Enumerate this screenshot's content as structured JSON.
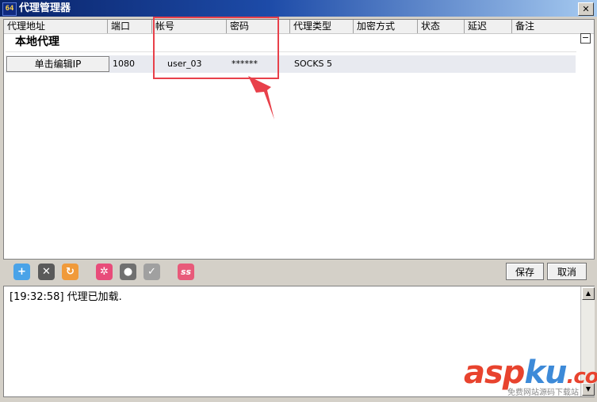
{
  "window": {
    "title": "代理管理器",
    "app_icon_text": "64",
    "close_glyph": "✕"
  },
  "columns": [
    {
      "label": "代理地址"
    },
    {
      "label": "端口"
    },
    {
      "label": "帐号"
    },
    {
      "label": "密码"
    },
    {
      "label": "代理类型"
    },
    {
      "label": "加密方式"
    },
    {
      "label": "状态"
    },
    {
      "label": "延迟"
    },
    {
      "label": "备注"
    }
  ],
  "group": {
    "title": "本地代理",
    "collapse_glyph": "−"
  },
  "rows": [
    {
      "address_button": "单击编辑IP",
      "port": "1080",
      "account": "user_03",
      "password": "******",
      "type": "SOCKS 5",
      "encryption": "",
      "status": "",
      "latency": "",
      "note": ""
    }
  ],
  "toolbar": {
    "icons": [
      {
        "name": "add-icon",
        "glyph": "+",
        "color": "#4aa3e8"
      },
      {
        "name": "delete-icon",
        "glyph": "✕",
        "color": "#5a5a5a"
      },
      {
        "name": "refresh-icon",
        "glyph": "↻",
        "color": "#f09a3a"
      },
      {
        "name": "settings-icon",
        "glyph": "✲",
        "color": "#e84c7a"
      },
      {
        "name": "bulb-icon",
        "glyph": "●",
        "color": "#707070"
      },
      {
        "name": "check-icon",
        "glyph": "✓",
        "color": "#a0a0a0"
      },
      {
        "name": "ss-icon",
        "glyph": "ss",
        "color": "#e85a7a"
      }
    ],
    "save_label": "保存",
    "cancel_label": "取消"
  },
  "log": {
    "lines": [
      "[19:32:58]  代理已加载."
    ]
  },
  "watermark": {
    "brand_asp": "asp",
    "brand_ku": "ku",
    "brand_rest": ".com",
    "sub": "免费网站源码下载站"
  },
  "colors": {
    "annotation": "#e8404a",
    "titlebar": "#0a246a",
    "accent": "#e8432e"
  }
}
